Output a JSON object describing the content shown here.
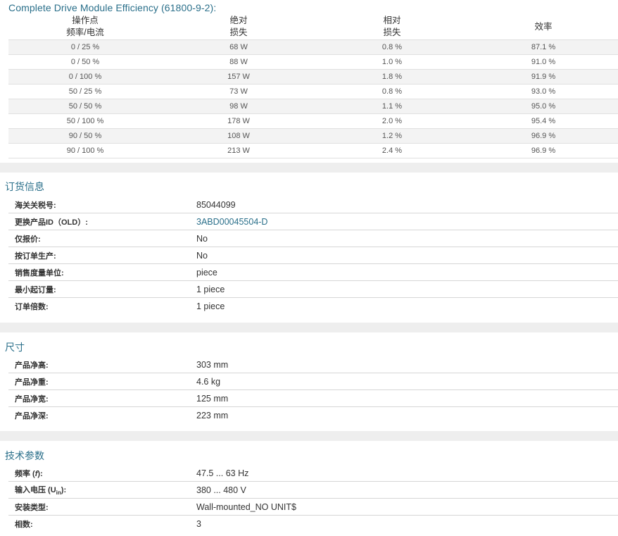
{
  "efficiency": {
    "title": "Complete Drive Module Efficiency (61800-9-2):",
    "headers": {
      "op_line1": "操作点",
      "op_line2": "频率/电流",
      "abs_line1": "绝对",
      "abs_line2": "损失",
      "rel_line1": "相对",
      "rel_line2": "损失",
      "eff": "效率"
    },
    "rows": [
      {
        "op": "0 / 25 %",
        "abs": "68 W",
        "rel": "0.8 %",
        "eff": "87.1 %"
      },
      {
        "op": "0 / 50 %",
        "abs": "88 W",
        "rel": "1.0 %",
        "eff": "91.0 %"
      },
      {
        "op": "0 / 100 %",
        "abs": "157 W",
        "rel": "1.8 %",
        "eff": "91.9 %"
      },
      {
        "op": "50 / 25 %",
        "abs": "73 W",
        "rel": "0.8 %",
        "eff": "93.0 %"
      },
      {
        "op": "50 / 50 %",
        "abs": "98 W",
        "rel": "1.1 %",
        "eff": "95.0 %"
      },
      {
        "op": "50 / 100 %",
        "abs": "178 W",
        "rel": "2.0 %",
        "eff": "95.4 %"
      },
      {
        "op": "90 / 50 %",
        "abs": "108 W",
        "rel": "1.2 %",
        "eff": "96.9 %"
      },
      {
        "op": "90 / 100 %",
        "abs": "213 W",
        "rel": "2.4 %",
        "eff": "96.9 %"
      }
    ]
  },
  "ordering": {
    "title": "订货信息",
    "rows": [
      {
        "key": "海关关税号:",
        "value": "85044099"
      },
      {
        "key": "更换产品ID（OLD）:",
        "value": "3ABD00045504-D"
      },
      {
        "key": "仅报价:",
        "value": "No"
      },
      {
        "key": "按订单生产:",
        "value": "No"
      },
      {
        "key": "销售度量单位:",
        "value": "piece"
      },
      {
        "key": "最小起订量:",
        "value": "1 piece"
      },
      {
        "key": "订单倍数:",
        "value": "1 piece"
      }
    ]
  },
  "dimensions": {
    "title": "尺寸",
    "rows": [
      {
        "key": "产品净高:",
        "value": "303 mm"
      },
      {
        "key": "产品净重:",
        "value": "4.6 kg"
      },
      {
        "key": "产品净宽:",
        "value": "125 mm"
      },
      {
        "key": "产品净深:",
        "value": "223 mm"
      }
    ]
  },
  "technical": {
    "title": "技术参数",
    "rows": [
      {
        "key_pre": "频率 (",
        "key_sym": "f",
        "key_post": "):",
        "value": "47.5 ... 63 Hz"
      },
      {
        "key_pre": "输入电压 (U",
        "key_sub": "in",
        "key_post": "):",
        "value": "380 ... 480 V"
      },
      {
        "key": "安装类型:",
        "value": "Wall-mounted_NO UNIT$"
      },
      {
        "key": "相数:",
        "value": "3"
      }
    ]
  }
}
